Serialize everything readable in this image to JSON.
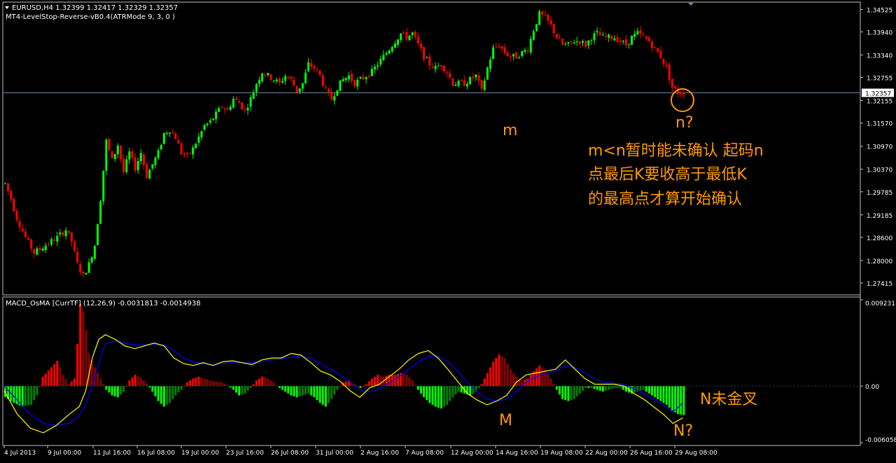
{
  "main_panel": {
    "symbol_line": "EURUSD,H4  1.32399 1.32417 1.32329 1.32357",
    "indicator_line": "MT4-LevelStop-Reverse-vB0.4(ATRMode 9, 3, 0 )",
    "current_price_label": "1.32357",
    "price_ticks": [
      1.34525,
      1.3394,
      1.3334,
      1.32755,
      1.32155,
      1.3157,
      1.3097,
      1.3037,
      1.29785,
      1.29185,
      1.286,
      1.28,
      1.27415
    ],
    "price_tick_labels": [
      "1.34525",
      "1.33940",
      "1.33340",
      "1.32755",
      "1.32155",
      "1.31570",
      "1.30970",
      "1.30370",
      "1.29785",
      "1.29185",
      "1.28600",
      "1.28000",
      "1.27415"
    ]
  },
  "sub_panel": {
    "title": "MACD_OsMA [CurrTF] (12,26,9) -0.0031813 -0.0014938",
    "tick_labels": [
      "0.009231",
      "0.00",
      "-0.006058"
    ]
  },
  "x_axis": {
    "labels": [
      "4 Jul 2013",
      "9 Jul 00:00",
      "11 Jul 16:00",
      "16 Jul 08:00",
      "19 Jul 00:00",
      "23 Jul 16:00",
      "26 Jul 08:00",
      "31 Jul 00:00",
      "2 Aug 16:00",
      "7 Aug 08:00",
      "12 Aug 00:00",
      "14 Aug 16:00",
      "19 Aug 08:00",
      "22 Aug 00:00",
      "26 Aug 16:00",
      "29 Aug 08:00"
    ]
  },
  "annotations": {
    "m_label": "m",
    "n_label": "n?",
    "note_line_1": "m<n暂时能未确认 起码n",
    "note_line_2": "点最后K要收高于最低K",
    "note_line_3": "的最高点才算开始确认",
    "M_label": "M",
    "N_label": "N?",
    "N_note": "N未金叉"
  },
  "colors": {
    "background": "#000000",
    "bull_candle": "#00ff00",
    "bear_candle": "#ff0000",
    "axis_text": "#ffffff",
    "grid_border": "#c0c0c0",
    "price_line": "#6b8aa8",
    "annotation": "#ff9900",
    "macd_line": "#ffff00",
    "signal_line": "#0000ff",
    "hist_up": "#ff0000",
    "hist_up_fade": "#8b0000",
    "hist_down": "#00ff00",
    "hist_down_fade": "#008000"
  },
  "chart_data": {
    "type": "candlestick",
    "symbol": "EURUSD",
    "timeframe": "H4",
    "ohlc_last": {
      "open": 1.32399,
      "high": 1.32417,
      "low": 1.32329,
      "close": 1.32357
    },
    "ylim": [
      1.2716,
      1.3466
    ],
    "close_path": [
      [
        0,
        1.3
      ],
      [
        2,
        1.296
      ],
      [
        4,
        1.291
      ],
      [
        7,
        1.286
      ],
      [
        10,
        1.282
      ],
      [
        14,
        1.284
      ],
      [
        18,
        1.286
      ],
      [
        21,
        1.288
      ],
      [
        23,
        1.285
      ],
      [
        25,
        1.279
      ],
      [
        27,
        1.276
      ],
      [
        29,
        1.279
      ],
      [
        31,
        1.284
      ],
      [
        33,
        1.296
      ],
      [
        35,
        1.311
      ],
      [
        37,
        1.306
      ],
      [
        39,
        1.31
      ],
      [
        41,
        1.303
      ],
      [
        43,
        1.308
      ],
      [
        45,
        1.304
      ],
      [
        47,
        1.308
      ],
      [
        49,
        1.302
      ],
      [
        51,
        1.305
      ],
      [
        53,
        1.308
      ],
      [
        55,
        1.313
      ],
      [
        57,
        1.314
      ],
      [
        59,
        1.312
      ],
      [
        61,
        1.308
      ],
      [
        63,
        1.307
      ],
      [
        65,
        1.309
      ],
      [
        67,
        1.312
      ],
      [
        69,
        1.315
      ],
      [
        71,
        1.316
      ],
      [
        73,
        1.318
      ],
      [
        75,
        1.32
      ],
      [
        77,
        1.319
      ],
      [
        79,
        1.322
      ],
      [
        81,
        1.321
      ],
      [
        83,
        1.319
      ],
      [
        85,
        1.322
      ],
      [
        87,
        1.326
      ],
      [
        89,
        1.329
      ],
      [
        91,
        1.328
      ],
      [
        93,
        1.327
      ],
      [
        95,
        1.326
      ],
      [
        97,
        1.328
      ],
      [
        99,
        1.327
      ],
      [
        101,
        1.324
      ],
      [
        103,
        1.326
      ],
      [
        105,
        1.331
      ],
      [
        107,
        1.33
      ],
      [
        109,
        1.328
      ],
      [
        111,
        1.324
      ],
      [
        113,
        1.322
      ],
      [
        115,
        1.325
      ],
      [
        117,
        1.327
      ],
      [
        119,
        1.328
      ],
      [
        121,
        1.326
      ],
      [
        123,
        1.327
      ],
      [
        125,
        1.328
      ],
      [
        127,
        1.329
      ],
      [
        129,
        1.331
      ],
      [
        131,
        1.333
      ],
      [
        133,
        1.335
      ],
      [
        135,
        1.337
      ],
      [
        137,
        1.339
      ],
      [
        139,
        1.338
      ],
      [
        141,
        1.339
      ],
      [
        143,
        1.336
      ],
      [
        145,
        1.333
      ],
      [
        147,
        1.331
      ],
      [
        149,
        1.33
      ],
      [
        151,
        1.331
      ],
      [
        153,
        1.329
      ],
      [
        155,
        1.326
      ],
      [
        157,
        1.326
      ],
      [
        159,
        1.326
      ],
      [
        161,
        1.327
      ],
      [
        163,
        1.328
      ],
      [
        165,
        1.324
      ],
      [
        167,
        1.33
      ],
      [
        169,
        1.335
      ],
      [
        171,
        1.336
      ],
      [
        173,
        1.334
      ],
      [
        175,
        1.333
      ],
      [
        177,
        1.333
      ],
      [
        179,
        1.334
      ],
      [
        181,
        1.335
      ],
      [
        183,
        1.34
      ],
      [
        185,
        1.344
      ],
      [
        187,
        1.343
      ],
      [
        189,
        1.341
      ],
      [
        191,
        1.338
      ],
      [
        193,
        1.336
      ],
      [
        195,
        1.336
      ],
      [
        197,
        1.337
      ],
      [
        199,
        1.337
      ],
      [
        201,
        1.336
      ],
      [
        203,
        1.338
      ],
      [
        205,
        1.339
      ],
      [
        207,
        1.338
      ],
      [
        209,
        1.338
      ],
      [
        211,
        1.338
      ],
      [
        213,
        1.337
      ],
      [
        215,
        1.336
      ],
      [
        217,
        1.338
      ],
      [
        219,
        1.339
      ],
      [
        221,
        1.338
      ],
      [
        223,
        1.337
      ],
      [
        225,
        1.335
      ],
      [
        227,
        1.333
      ],
      [
        229,
        1.33
      ],
      [
        231,
        1.325
      ],
      [
        233,
        1.3236
      ],
      [
        235,
        1.3236
      ]
    ],
    "histogram": [
      [
        0,
        -0.0012
      ],
      [
        3,
        -0.0018
      ],
      [
        6,
        -0.0022
      ],
      [
        9,
        -0.002
      ],
      [
        11,
        -0.001
      ],
      [
        13,
        0.001
      ],
      [
        16,
        0.002
      ],
      [
        18,
        0.0027
      ],
      [
        20,
        0.0012
      ],
      [
        22,
        0.0002
      ],
      [
        24,
        0.0008
      ],
      [
        25,
        0.0045
      ],
      [
        26,
        0.0088
      ],
      [
        27,
        0.008
      ],
      [
        28,
        0.006
      ],
      [
        29,
        0.0035
      ],
      [
        31,
        0.002
      ],
      [
        33,
        0.0008
      ],
      [
        35,
        -0.0004
      ],
      [
        37,
        -0.001
      ],
      [
        39,
        -0.0012
      ],
      [
        41,
        -0.0006
      ],
      [
        43,
        0.0006
      ],
      [
        45,
        0.0012
      ],
      [
        47,
        0.0009
      ],
      [
        49,
        0.0003
      ],
      [
        51,
        -0.0006
      ],
      [
        53,
        -0.0016
      ],
      [
        55,
        -0.0022
      ],
      [
        57,
        -0.0018
      ],
      [
        59,
        -0.001
      ],
      [
        61,
        -0.0004
      ],
      [
        63,
        0.0004
      ],
      [
        65,
        0.0008
      ],
      [
        67,
        0.001
      ],
      [
        69,
        0.0008
      ],
      [
        71,
        0.0006
      ],
      [
        73,
        0.0005
      ],
      [
        75,
        0.0004
      ],
      [
        77,
        0.0001
      ],
      [
        79,
        -0.0004
      ],
      [
        81,
        -0.001
      ],
      [
        83,
        -0.0008
      ],
      [
        85,
        -0.0002
      ],
      [
        87,
        0.0006
      ],
      [
        89,
        0.001
      ],
      [
        91,
        0.0008
      ],
      [
        93,
        0.0004
      ],
      [
        95,
        -0.0002
      ],
      [
        97,
        -0.0006
      ],
      [
        99,
        -0.001
      ],
      [
        101,
        -0.0012
      ],
      [
        103,
        -0.001
      ],
      [
        105,
        -0.0008
      ],
      [
        107,
        -0.0012
      ],
      [
        109,
        -0.0018
      ],
      [
        111,
        -0.0022
      ],
      [
        113,
        -0.0014
      ],
      [
        115,
        -0.0004
      ],
      [
        117,
        0.0004
      ],
      [
        119,
        0.0006
      ],
      [
        121,
        0.0002
      ],
      [
        123,
        -0.0002
      ],
      [
        125,
        0.0002
      ],
      [
        127,
        0.0008
      ],
      [
        129,
        0.0012
      ],
      [
        131,
        0.001
      ],
      [
        133,
        0.0012
      ],
      [
        135,
        0.0012
      ],
      [
        137,
        0.0014
      ],
      [
        139,
        0.0012
      ],
      [
        141,
        0.0006
      ],
      [
        143,
        -0.0004
      ],
      [
        145,
        -0.0012
      ],
      [
        147,
        -0.0018
      ],
      [
        149,
        -0.0022
      ],
      [
        151,
        -0.0024
      ],
      [
        153,
        -0.002
      ],
      [
        155,
        -0.0012
      ],
      [
        157,
        -0.0006
      ],
      [
        159,
        -0.0008
      ],
      [
        161,
        -0.001
      ],
      [
        163,
        -0.0006
      ],
      [
        165,
        0.0002
      ],
      [
        167,
        0.0014
      ],
      [
        169,
        0.0026
      ],
      [
        171,
        0.0034
      ],
      [
        173,
        0.003
      ],
      [
        175,
        0.0018
      ],
      [
        177,
        0.001
      ],
      [
        179,
        0.0006
      ],
      [
        181,
        0.0008
      ],
      [
        183,
        0.0016
      ],
      [
        185,
        0.0022
      ],
      [
        187,
        0.0018
      ],
      [
        189,
        0.0008
      ],
      [
        191,
        -0.0004
      ],
      [
        193,
        -0.0014
      ],
      [
        195,
        -0.0016
      ],
      [
        197,
        -0.0014
      ],
      [
        199,
        -0.0008
      ],
      [
        201,
        -0.0002
      ],
      [
        203,
        -0.0002
      ],
      [
        205,
        -0.0004
      ],
      [
        207,
        -0.0006
      ],
      [
        209,
        -0.0004
      ],
      [
        211,
        -0.0002
      ],
      [
        213,
        -0.0002
      ],
      [
        215,
        -0.0006
      ],
      [
        217,
        -0.0008
      ],
      [
        219,
        -0.0006
      ],
      [
        221,
        -0.0004
      ],
      [
        223,
        -0.0008
      ],
      [
        225,
        -0.0012
      ],
      [
        227,
        -0.0016
      ],
      [
        229,
        -0.002
      ],
      [
        231,
        -0.0026
      ],
      [
        233,
        -0.003
      ],
      [
        235,
        -0.0031
      ]
    ],
    "macd_line": [
      [
        0,
        -0.0005
      ],
      [
        4,
        -0.003
      ],
      [
        8,
        -0.0045
      ],
      [
        12,
        -0.005
      ],
      [
        16,
        -0.0042
      ],
      [
        20,
        -0.003
      ],
      [
        23,
        -0.0022
      ],
      [
        25,
        -0.0005
      ],
      [
        27,
        0.003
      ],
      [
        29,
        0.005
      ],
      [
        31,
        0.0055
      ],
      [
        34,
        0.005
      ],
      [
        37,
        0.0043
      ],
      [
        40,
        0.004
      ],
      [
        43,
        0.0043
      ],
      [
        46,
        0.0046
      ],
      [
        49,
        0.0043
      ],
      [
        52,
        0.003
      ],
      [
        55,
        0.0024
      ],
      [
        58,
        0.0022
      ],
      [
        61,
        0.0025
      ],
      [
        64,
        0.0022
      ],
      [
        67,
        0.0026
      ],
      [
        70,
        0.0027
      ],
      [
        73,
        0.0025
      ],
      [
        76,
        0.0023
      ],
      [
        79,
        0.0028
      ],
      [
        82,
        0.003
      ],
      [
        85,
        0.003
      ],
      [
        88,
        0.0035
      ],
      [
        91,
        0.0033
      ],
      [
        94,
        0.0025
      ],
      [
        97,
        0.0016
      ],
      [
        100,
        0.0012
      ],
      [
        103,
        0.0005
      ],
      [
        106,
        -0.0005
      ],
      [
        109,
        -0.0012
      ],
      [
        112,
        -0.0002
      ],
      [
        115,
        0.0002
      ],
      [
        118,
        0.001
      ],
      [
        121,
        0.0018
      ],
      [
        124,
        0.0028
      ],
      [
        127,
        0.0035
      ],
      [
        130,
        0.0038
      ],
      [
        133,
        0.003
      ],
      [
        136,
        0.0018
      ],
      [
        139,
        0.0005
      ],
      [
        142,
        -0.0008
      ],
      [
        145,
        -0.0015
      ],
      [
        148,
        -0.002
      ],
      [
        151,
        -0.0016
      ],
      [
        154,
        -0.001
      ],
      [
        157,
        0.0004
      ],
      [
        160,
        0.0012
      ],
      [
        163,
        0.0014
      ],
      [
        166,
        0.0016
      ],
      [
        169,
        0.0018
      ],
      [
        172,
        0.0028
      ],
      [
        175,
        0.0018
      ],
      [
        178,
        0.0008
      ],
      [
        181,
        0.0002
      ],
      [
        184,
        0.0002
      ],
      [
        187,
        0.0002
      ],
      [
        190,
        0.0
      ],
      [
        193,
        -0.0008
      ],
      [
        196,
        -0.0014
      ],
      [
        199,
        -0.0022
      ],
      [
        202,
        -0.003
      ],
      [
        205,
        -0.004
      ],
      [
        208,
        -0.0034
      ]
    ],
    "signal_line": [
      [
        0,
        0.0
      ],
      [
        4,
        -0.0015
      ],
      [
        8,
        -0.003
      ],
      [
        12,
        -0.004
      ],
      [
        16,
        -0.0042
      ],
      [
        20,
        -0.004
      ],
      [
        23,
        -0.0032
      ],
      [
        25,
        -0.002
      ],
      [
        27,
        0.0
      ],
      [
        29,
        0.0025
      ],
      [
        31,
        0.0045
      ],
      [
        34,
        0.0048
      ],
      [
        37,
        0.0046
      ],
      [
        40,
        0.0044
      ],
      [
        43,
        0.0044
      ],
      [
        46,
        0.0045
      ],
      [
        49,
        0.0044
      ],
      [
        52,
        0.0038
      ],
      [
        55,
        0.003
      ],
      [
        58,
        0.0026
      ],
      [
        61,
        0.0024
      ],
      [
        64,
        0.0023
      ],
      [
        67,
        0.0024
      ],
      [
        70,
        0.0025
      ],
      [
        73,
        0.0025
      ],
      [
        76,
        0.0025
      ],
      [
        79,
        0.0026
      ],
      [
        82,
        0.0028
      ],
      [
        85,
        0.0029
      ],
      [
        88,
        0.0031
      ],
      [
        91,
        0.0032
      ],
      [
        94,
        0.003
      ],
      [
        97,
        0.0024
      ],
      [
        100,
        0.0018
      ],
      [
        103,
        0.0012
      ],
      [
        106,
        0.0004
      ],
      [
        109,
        -0.0004
      ],
      [
        112,
        -0.0006
      ],
      [
        115,
        -0.0003
      ],
      [
        118,
        0.0003
      ],
      [
        121,
        0.001
      ],
      [
        124,
        0.0018
      ],
      [
        127,
        0.0026
      ],
      [
        130,
        0.0032
      ],
      [
        133,
        0.0032
      ],
      [
        136,
        0.0026
      ],
      [
        139,
        0.0016
      ],
      [
        142,
        0.0004
      ],
      [
        145,
        -0.0006
      ],
      [
        148,
        -0.0014
      ],
      [
        151,
        -0.0016
      ],
      [
        154,
        -0.0014
      ],
      [
        157,
        -0.0006
      ],
      [
        160,
        0.0004
      ],
      [
        163,
        0.001
      ],
      [
        166,
        0.0013
      ],
      [
        169,
        0.0016
      ],
      [
        172,
        0.0022
      ],
      [
        175,
        0.002
      ],
      [
        178,
        0.0014
      ],
      [
        181,
        0.0008
      ],
      [
        184,
        0.0004
      ],
      [
        187,
        0.0003
      ],
      [
        190,
        0.0002
      ],
      [
        193,
        -0.0003
      ],
      [
        196,
        -0.0008
      ],
      [
        199,
        -0.0014
      ],
      [
        202,
        -0.002
      ],
      [
        205,
        -0.0028
      ],
      [
        208,
        -0.0018
      ]
    ],
    "sub_ylim": [
      -0.006058,
      0.009231
    ],
    "horizontal_line_price": 1.32357
  }
}
